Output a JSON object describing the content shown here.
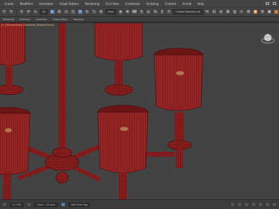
{
  "menu": {
    "items": [
      "Create",
      "Modifiers",
      "Animation",
      "Graph Editors",
      "Rendering",
      "Civil View",
      "Customize",
      "Scripting",
      "Content",
      "Arnold",
      "Help"
    ]
  },
  "toolbar": {
    "selection_filter": "All",
    "view_dropdown": "View",
    "selection_set": "Create Selection Se"
  },
  "subbar": {
    "items": [
      "Modeling",
      "Freeform",
      "Selection",
      "Object Paint",
      "Populate"
    ]
  },
  "viewport": {
    "label": "[+] [Perspective] [Standard] [Edged Faces]",
    "mesh_color": "#8e1f1f",
    "wire_color": "#3a0a0a",
    "background": "#434343"
  },
  "statusbar": {
    "frame": "0 / 100",
    "grid": "Grid = 10.0cm",
    "time_tag": "Add Time Tag"
  }
}
